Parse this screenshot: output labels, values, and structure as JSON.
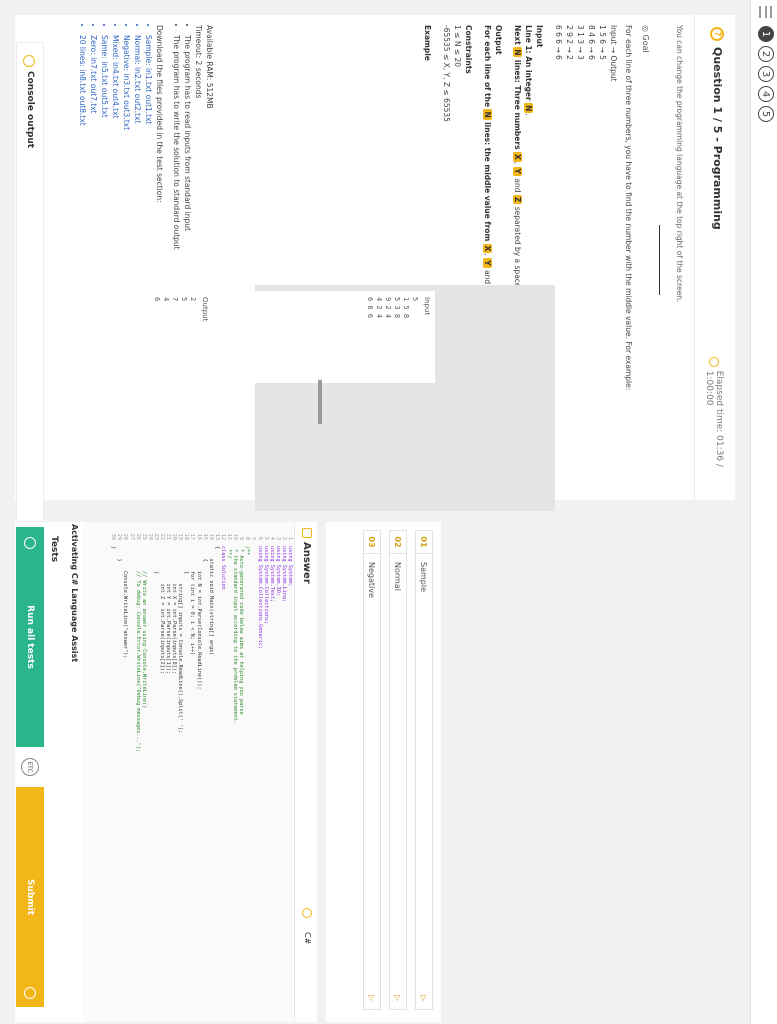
{
  "nav": {
    "steps": [
      "1",
      "2",
      "3",
      "4",
      "5"
    ]
  },
  "question": {
    "title": "Question 1 / 5 - Programming",
    "elapsed": "Elapsed time: 01:36 / 1:00:00",
    "instruction": "You can change the programming language at the top right of the screen.",
    "goal_label": "Goal",
    "goal_text": "For each line of three numbers, you have to find the number with the middle value. For example:",
    "example_header": "Input → Output",
    "example_lines": [
      "1 5 6 → 5",
      "8 4 6 → 6",
      "3 1 3 → 3",
      "2 9 2 → 2",
      "6 6 6 → 6"
    ],
    "input_head": "Input",
    "input_line1_pre": "Line 1: An integer",
    "input_line1_var": "N",
    "input_next_pre": "Next",
    "input_next_var": "N",
    "input_next_mid": "lines: Three numbers",
    "var_x": "X",
    "var_y": "Y",
    "var_z": "Z",
    "input_next_post": "separated by a space.",
    "output_head": "Output",
    "output_pre": "For each line of the",
    "output_var": "N",
    "output_mid": "lines: the middle value from",
    "output_and": "and",
    "constraints_head": "Constraints",
    "constraint1": "1 ≤ N ≤ 20",
    "constraint2": "-65535 ≤ X, Y, Z ≤ 65535",
    "example_head": "Example",
    "example_input_label": "Input",
    "example_input_lines": [
      "5",
      "1 5 8",
      "5 3 8",
      "9 2 4",
      "4 2 4",
      "6 6 6"
    ],
    "example_output_label": "Output",
    "example_output_lines": [
      "2",
      "5",
      "7",
      "4",
      "6"
    ],
    "ram": "Available RAM: 512MB",
    "timeout": "Timeout: 2 seconds",
    "rules": [
      "The program has to read inputs from standard input",
      "The program has to write the solution to standard output"
    ],
    "download_text": "Download the files provided in the test section:",
    "files": [
      "Sample: in1.txt out1.txt",
      "Normal: in2.txt out2.txt",
      "Negative: in3.txt out3.txt",
      "Mixed: in4.txt out4.txt",
      "Same: in5.txt out5.txt",
      "Zero: in7.txt out7.txt",
      "20 lines: in8.txt out8.txt"
    ]
  },
  "answer": {
    "title": "Answer",
    "language": "C#",
    "assist": "Activating C# Language Assist",
    "code": [
      "using System;",
      "using System.Linq;",
      "using System.IO;",
      "using System.Text;",
      "using System.Collections;",
      "using System.Collections.Generic;",
      "",
      "/**",
      " * Auto-generated code below aims at helping you parse",
      " * the standard input according to the problem statement.",
      " **/",
      "class Solution",
      "{",
      "    static void Main(string[] args)",
      "    {",
      "        int N = int.Parse(Console.ReadLine());",
      "        for (int i = 0; i < N; i++)",
      "        {",
      "            string[] inputs = Console.ReadLine().Split(' ');",
      "            int X = int.Parse(inputs[0]);",
      "            int Y = int.Parse(inputs[1]);",
      "            int Z = int.Parse(inputs[2]);",
      "        }",
      "",
      "        // Write an answer using Console.WriteLine()",
      "        // To debug: Console.Error.WriteLine(\"Debug messages...\");",
      "",
      "        Console.WriteLine(\"answer\");",
      "    }",
      "}"
    ]
  },
  "tests": {
    "title": "Tests",
    "items": [
      {
        "num": "01",
        "label": "Sample"
      },
      {
        "num": "02",
        "label": "Normal"
      },
      {
        "num": "03",
        "label": "Negative"
      }
    ]
  },
  "console": {
    "label": "Console output"
  },
  "actions": {
    "run_label": "Run all tests",
    "submit_label": "Submit",
    "mid_icon": "ETC"
  },
  "colors": {
    "accent": "#f2b619",
    "run": "#2bb58c",
    "link": "#2d64c4"
  }
}
